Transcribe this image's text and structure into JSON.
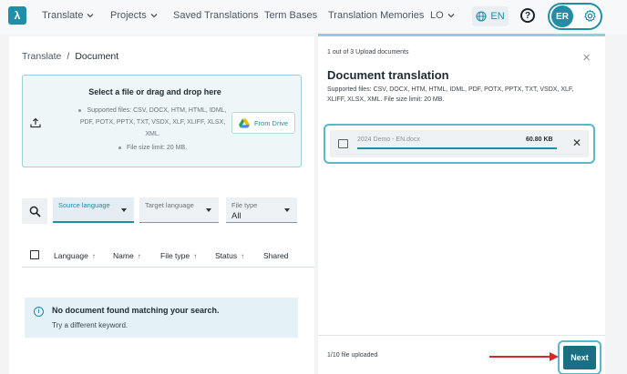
{
  "nav": {
    "items": [
      {
        "label": "Translate",
        "has_chevron": true
      },
      {
        "label": "Projects",
        "has_chevron": true
      },
      {
        "label": "Saved Translations",
        "has_chevron": false
      },
      {
        "label": "Term Bases",
        "has_chevron": false
      },
      {
        "label": "Translation Memories",
        "has_chevron": false
      },
      {
        "label": "LO",
        "has_chevron": true
      }
    ],
    "language": "EN",
    "help_glyph": "?",
    "user_initials": "ER",
    "logo_glyph": "λ"
  },
  "breadcrumb": {
    "root": "Translate",
    "separator": "/",
    "current": "Document"
  },
  "dropzone": {
    "title": "Select a file or drag and drop here",
    "supported": "Supported files: CSV, DOCX, HTM, HTML, IDML, PDF, POTX, PPTX, TXT, VSDX, XLF, XLIFF, XLSX, XML.",
    "limit": "File size limit: 20 MB.",
    "from_drive_label": "From Drive"
  },
  "filters": {
    "source_language": {
      "label": "Source language",
      "value": ""
    },
    "target_language": {
      "label": "Target language",
      "value": ""
    },
    "file_type": {
      "label": "File type",
      "value": "All"
    }
  },
  "table": {
    "columns": [
      "Language",
      "Name",
      "File type",
      "Status",
      "Shared"
    ],
    "sort_glyph": "↑"
  },
  "empty_state": {
    "title": "No document found matching your search.",
    "subtitle": "Try a different keyword."
  },
  "panel": {
    "progress": "1 out of 3 Upload documents",
    "title": "Document translation",
    "subtitle": "Supported files: CSV, DOCX, HTM, HTML, IDML, PDF, POTX, PPTX, TXT, VSDX, XLF, XLIFF, XLSX, XML. File size limit: 20 MB.",
    "file": {
      "name": "2024 Demo - EN.docx",
      "size": "60.80 KB",
      "upload_progress": 1.0
    },
    "uploaded_count": "1/10 file uploaded",
    "next_label": "Next",
    "close_glyph": "✕"
  },
  "colors": {
    "accent": "#1f8ea6",
    "primary_button": "#1a6f82",
    "highlight_border": "#5bb7c9",
    "annotation_arrow": "#d62828"
  }
}
